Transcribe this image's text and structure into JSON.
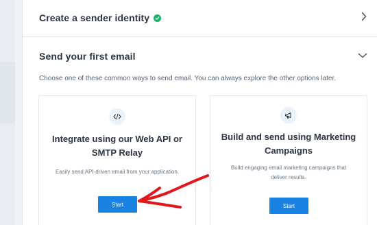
{
  "sender_identity": {
    "title": "Create a sender identity",
    "status_icon": "check-circle-icon",
    "status_color": "#1fb36b"
  },
  "first_email": {
    "title": "Send your first email",
    "subtitle": "Choose one of these common ways to send email. You can always explore the other options later."
  },
  "cards": [
    {
      "icon": "code-icon",
      "title_line1": "Integrate using our Web API or",
      "title_line2": "SMTP Relay",
      "desc_line1": "Easily send API-driven email from your application.",
      "button": "Start"
    },
    {
      "icon": "megaphone-icon",
      "title_line1": "Build and send using Marketing",
      "title_line2": "Campaigns",
      "desc_line1": "Build engaging email marketing campaigns that",
      "desc_line2": "deliver results.",
      "button": "Start"
    }
  ],
  "colors": {
    "accent": "#1a82e2",
    "annotation_arrow": "#e0181b"
  }
}
